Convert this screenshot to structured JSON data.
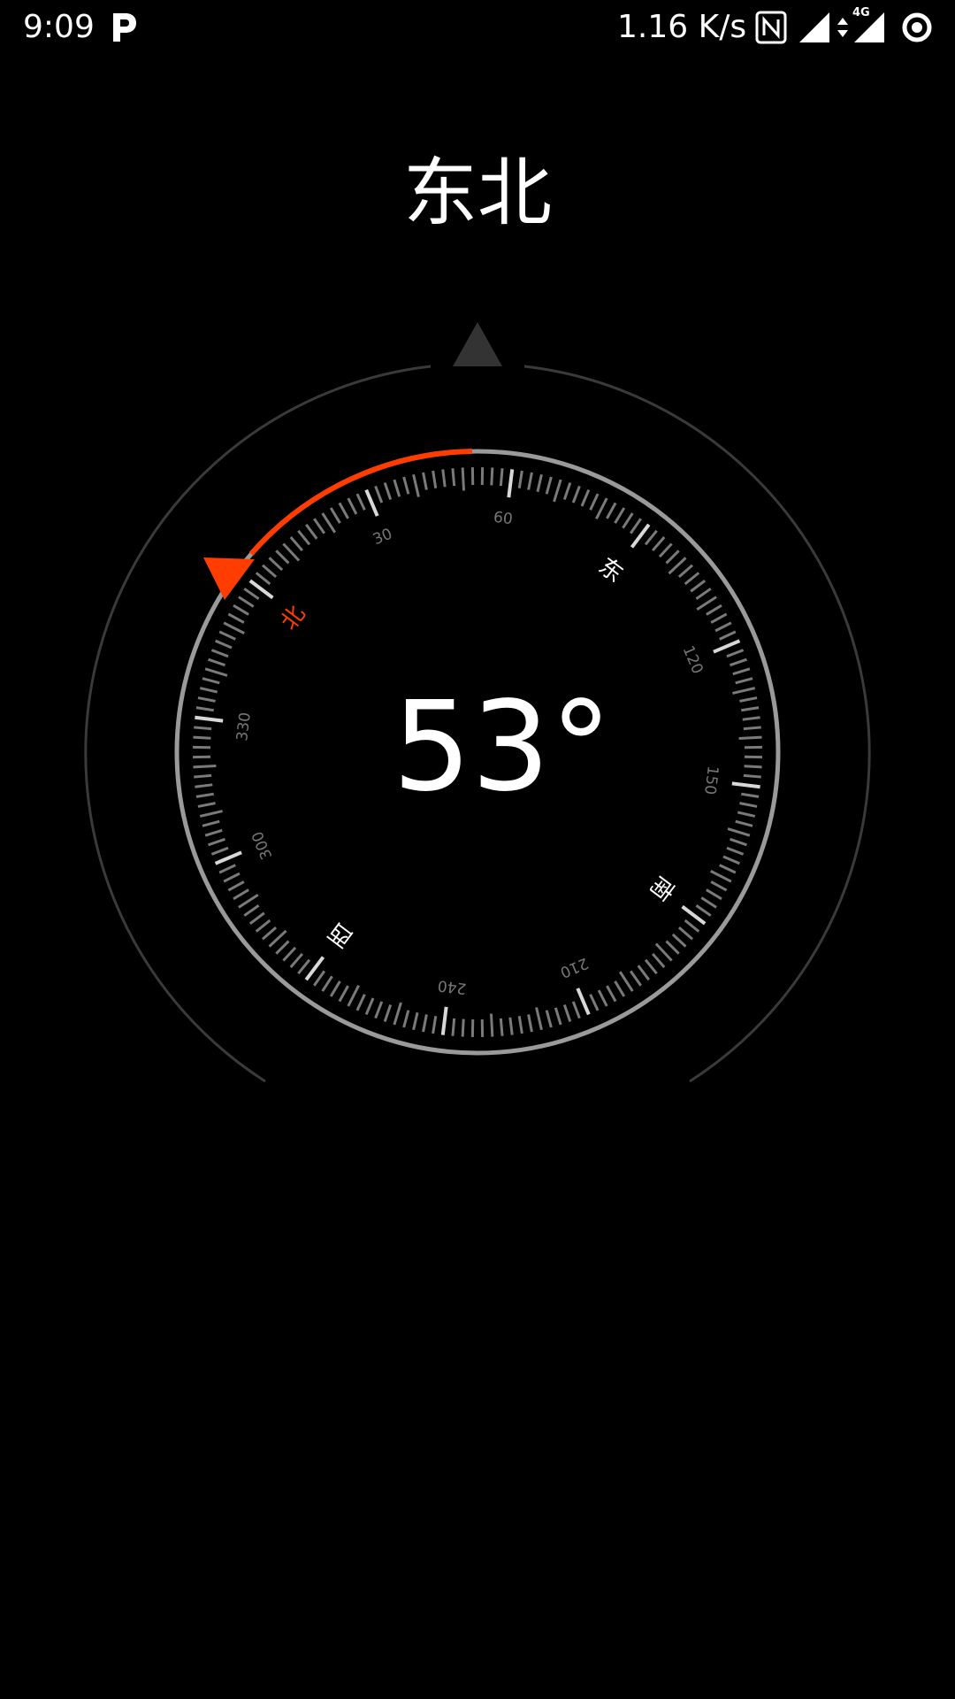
{
  "status_bar": {
    "time": "9:09",
    "network_speed": "1.16 K/s",
    "network_type": "4G",
    "icons": [
      "parking-app-icon",
      "nfc-icon",
      "signal-icon",
      "data-arrows-icon",
      "signal-4g-icon",
      "vpn-ring-icon"
    ]
  },
  "compass": {
    "direction_label": "东北",
    "heading_value": "53",
    "heading_unit": "°",
    "heading_degrees": 53,
    "degree_labels": [
      "30",
      "60",
      "120",
      "150",
      "210",
      "240",
      "300",
      "330"
    ],
    "cardinals": {
      "north": "北",
      "east": "东",
      "south": "南",
      "west": "西"
    },
    "colors": {
      "accent": "#ff3d00",
      "ring": "#9a9a9a",
      "outer_ring": "#3a3a3a",
      "pointer": "#333333"
    }
  }
}
